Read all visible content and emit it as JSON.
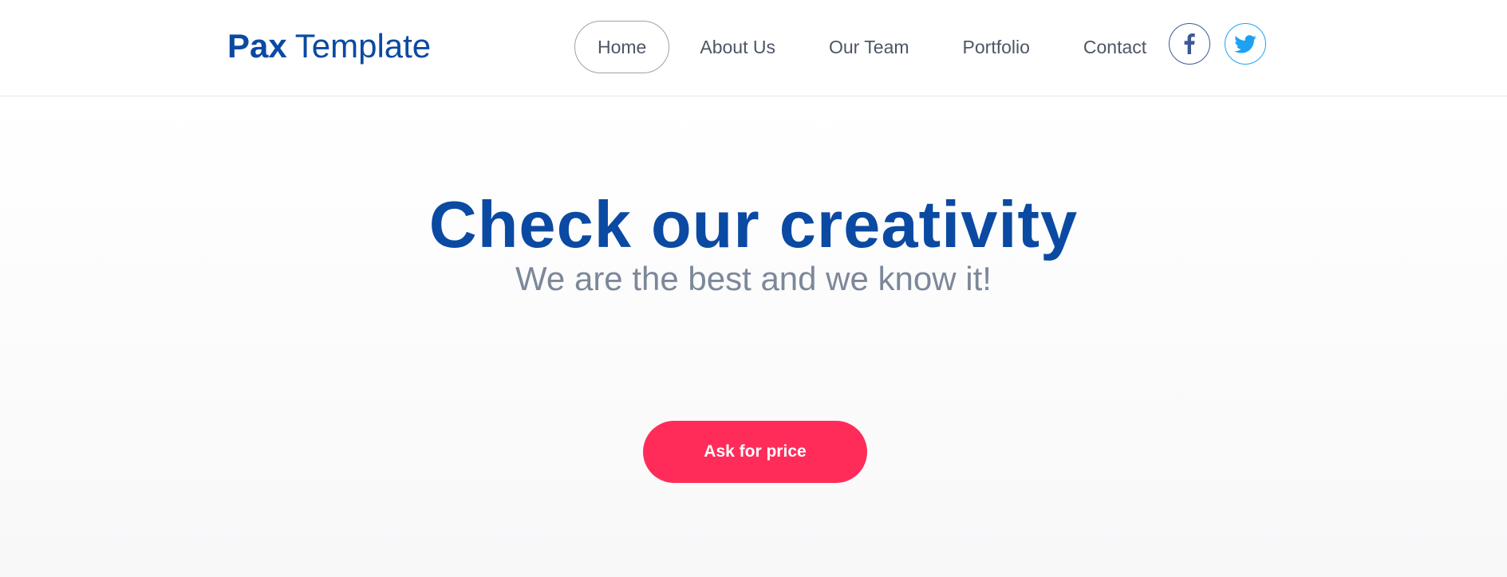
{
  "brand": {
    "name_bold": "Pax",
    "name_light": "Template",
    "color": "#0b4aa2"
  },
  "nav": {
    "items": [
      {
        "label": "Home",
        "active": true
      },
      {
        "label": "About Us",
        "active": false
      },
      {
        "label": "Our Team",
        "active": false
      },
      {
        "label": "Portfolio",
        "active": false
      },
      {
        "label": "Contact",
        "active": false
      }
    ]
  },
  "social": {
    "facebook": {
      "icon": "facebook-icon",
      "color": "#3b5998"
    },
    "twitter": {
      "icon": "twitter-icon",
      "color": "#1da1f2"
    }
  },
  "hero": {
    "title": "Check our creativity",
    "subtitle": "We are the best and we know it!",
    "cta_label": "Ask for price",
    "cta_color": "#ff2c5a"
  }
}
